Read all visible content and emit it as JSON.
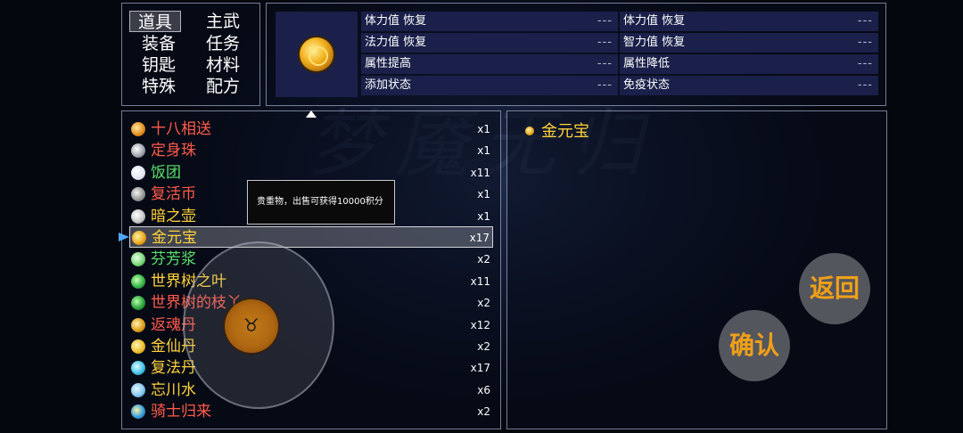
{
  "categories": [
    "道具",
    "主武",
    "装备",
    "任务",
    "钥匙",
    "材料",
    "特殊",
    "配方"
  ],
  "selected_category": "道具",
  "stats_left": [
    {
      "label": "体力值 恢复",
      "value": "---"
    },
    {
      "label": "法力值 恢复",
      "value": "---"
    },
    {
      "label": "属性提高",
      "value": "---"
    },
    {
      "label": "添加状态",
      "value": "---"
    }
  ],
  "stats_right": [
    {
      "label": "体力值 恢复",
      "value": "---"
    },
    {
      "label": "智力值 恢复",
      "value": "---"
    },
    {
      "label": "属性降低",
      "value": "---"
    },
    {
      "label": "免疫状态",
      "value": "---"
    }
  ],
  "items": [
    {
      "name": "十八相送",
      "qty": "x1",
      "color": "red",
      "icon": "orb-icon"
    },
    {
      "name": "定身珠",
      "qty": "x1",
      "color": "red",
      "icon": "pearl-icon"
    },
    {
      "name": "饭团",
      "qty": "x11",
      "color": "green",
      "icon": "rice-ball-icon"
    },
    {
      "name": "复活币",
      "qty": "x1",
      "color": "red",
      "icon": "coin-icon"
    },
    {
      "name": "暗之壶",
      "qty": "x1",
      "color": "yellow",
      "icon": "potion-icon"
    },
    {
      "name": "金元宝",
      "qty": "x17",
      "color": "yellow",
      "icon": "gold-ingot-icon"
    },
    {
      "name": "芬芳浆",
      "qty": "x2",
      "color": "green",
      "icon": "flask-icon"
    },
    {
      "name": "世界树之叶",
      "qty": "x11",
      "color": "yellow",
      "icon": "leaf-icon"
    },
    {
      "name": "世界树的枝丫",
      "qty": "x2",
      "color": "red",
      "icon": "branch-icon"
    },
    {
      "name": "返魂丹",
      "qty": "x12",
      "color": "red",
      "icon": "pill-icon"
    },
    {
      "name": "金仙丹",
      "qty": "x2",
      "color": "yellow",
      "icon": "gold-pill-icon"
    },
    {
      "name": "复法丹",
      "qty": "x17",
      "color": "yellow",
      "icon": "mana-pill-icon"
    },
    {
      "name": "忘川水",
      "qty": "x6",
      "color": "yellow",
      "icon": "water-drop-icon"
    },
    {
      "name": "骑士归来",
      "qty": "x2",
      "color": "red",
      "icon": "eye-icon"
    }
  ],
  "selected_item": "金元宝",
  "tooltip": "贵重物，出售可获得10000积分",
  "detail": {
    "name": "金元宝"
  },
  "buttons": {
    "back": "返回",
    "confirm": "确认"
  },
  "watermark": "梦魇无归"
}
